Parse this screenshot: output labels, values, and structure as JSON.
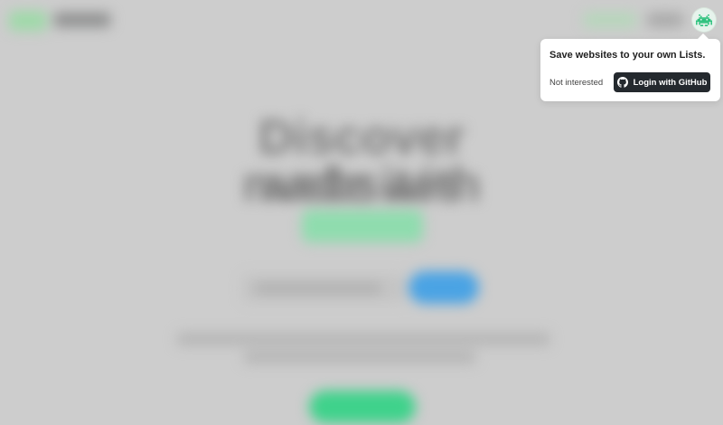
{
  "colors": {
    "background": "#cdcdcd",
    "brand_green": "#3fd28b",
    "accent_blue": "#4aa3e4",
    "github_dark": "#24292e"
  },
  "hero": {
    "title_line_1": "Discover websites",
    "title_line_2": "made with"
  },
  "user_menu": {
    "avatar_icon": "space-invader-icon"
  },
  "popover": {
    "message": "Save websites to your own Lists.",
    "dismiss_label": "Not interested",
    "login_label": "Login with GitHub",
    "login_icon": "github-icon"
  }
}
